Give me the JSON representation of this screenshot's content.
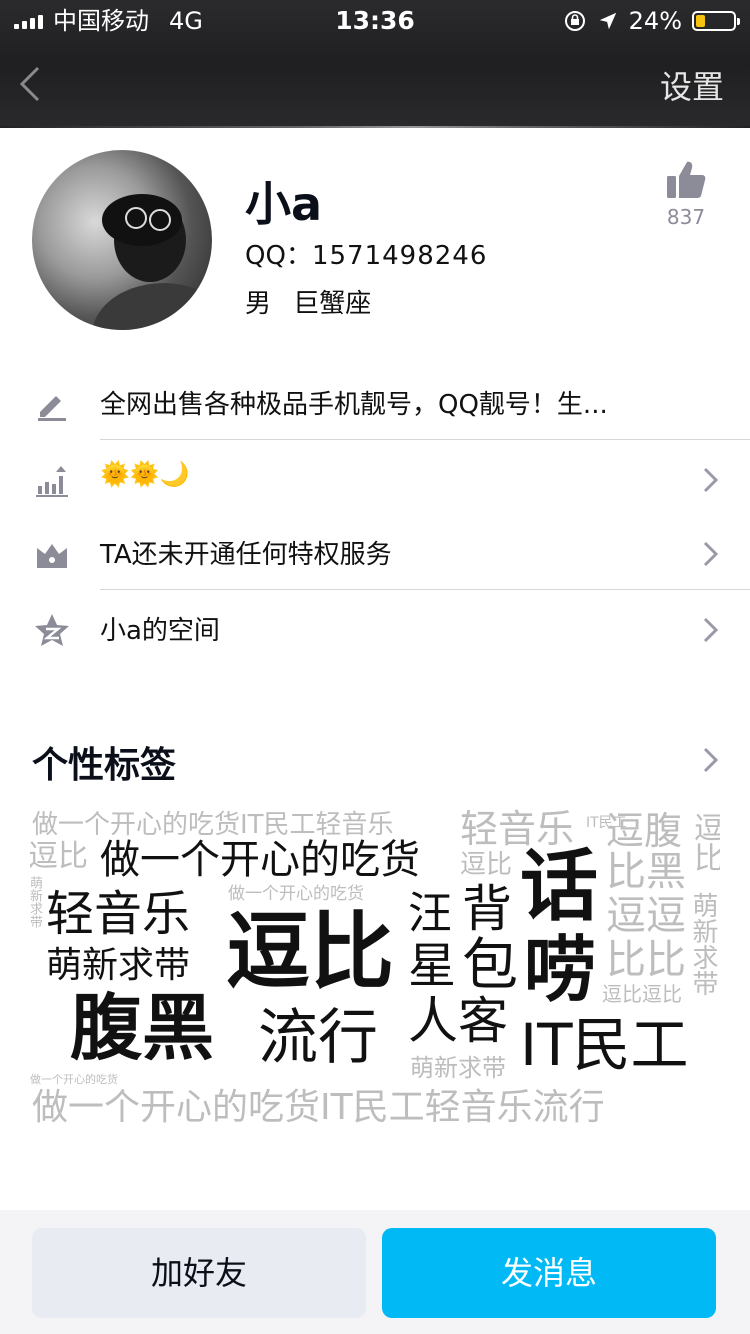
{
  "status_bar": {
    "carrier": "中国移动",
    "network": "4G",
    "time": "13:36",
    "battery": "24%",
    "battery_level": 0.24
  },
  "nav": {
    "settings_label": "设置"
  },
  "profile": {
    "name": "小a",
    "qq_label": "QQ：",
    "qq_number": "1571498246",
    "gender": "男",
    "constellation": "巨蟹座",
    "likes": "837"
  },
  "rows": {
    "signature": "全网出售各种极品手机靓号，QQ靓号！生...",
    "level_emoji": "🌞🌞🌙",
    "privilege": "TA还未开通任何特权服务",
    "space": "小a的空间"
  },
  "tags_section": {
    "title": "个性标签"
  },
  "tag_cloud": {
    "w01": "做一个开心的吃货IT民工轻音乐",
    "w02": "逗比",
    "w03": "轻音乐",
    "w04": "IT民工",
    "w05": "逗腹",
    "w06": "逗比",
    "w07": "做一个开心的吃货",
    "w08": "逗比",
    "w09": "话",
    "w10": "比黑",
    "w11": "萌新求带",
    "w12": "轻音乐",
    "w13": "做一个开心的吃货",
    "w14": "汪",
    "w15": "背",
    "w16": "逗逗",
    "w17": "萌新求带",
    "w18": "逗比",
    "w19": "星",
    "w20": "包",
    "w21": "唠",
    "w22": "比比",
    "w23": "萌新求带",
    "w24": "逗比逗比",
    "w25": "腹黑",
    "w26": "流行",
    "w27": "人客",
    "w28": "IT民工",
    "w29": "做一个开心的吃货",
    "w30": "萌新求带",
    "w31": "做一个开心的吃货IT民工轻音乐流行"
  },
  "actions": {
    "add_friend": "加好友",
    "send_message": "发消息"
  },
  "colors": {
    "accent": "#00b9f5",
    "header_bg": "#252527",
    "icon_gray": "#8c8c99"
  }
}
